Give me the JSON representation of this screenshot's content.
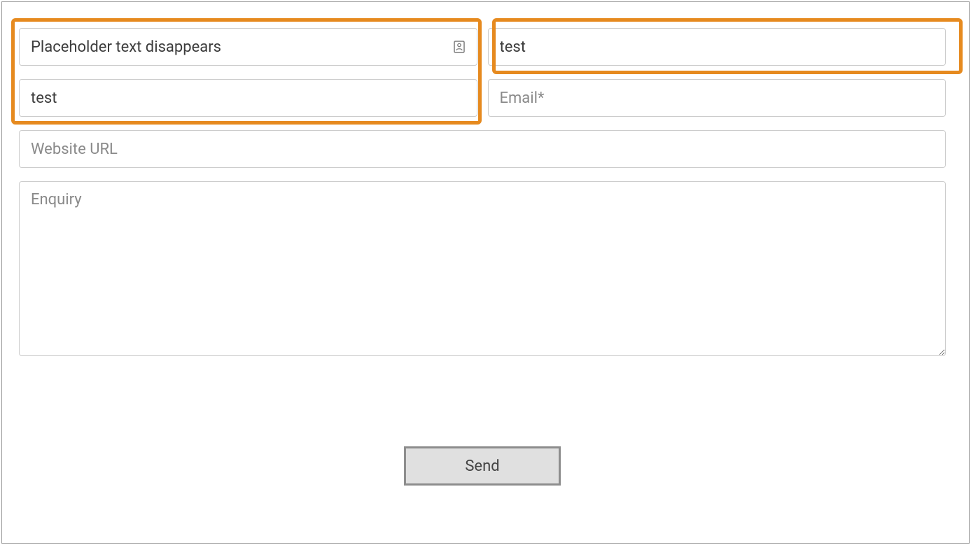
{
  "form": {
    "name_input": {
      "value": "Placeholder text disappears",
      "placeholder": ""
    },
    "surname_input": {
      "value": "test",
      "placeholder": ""
    },
    "phone_input": {
      "value": "test",
      "placeholder": ""
    },
    "email_input": {
      "value": "",
      "placeholder": "Email*"
    },
    "website_input": {
      "value": "",
      "placeholder": "Website URL"
    },
    "enquiry_textarea": {
      "value": "",
      "placeholder": "Enquiry"
    },
    "submit_label": "Send"
  },
  "annotation": {
    "highlight_color": "#e68a1f"
  }
}
